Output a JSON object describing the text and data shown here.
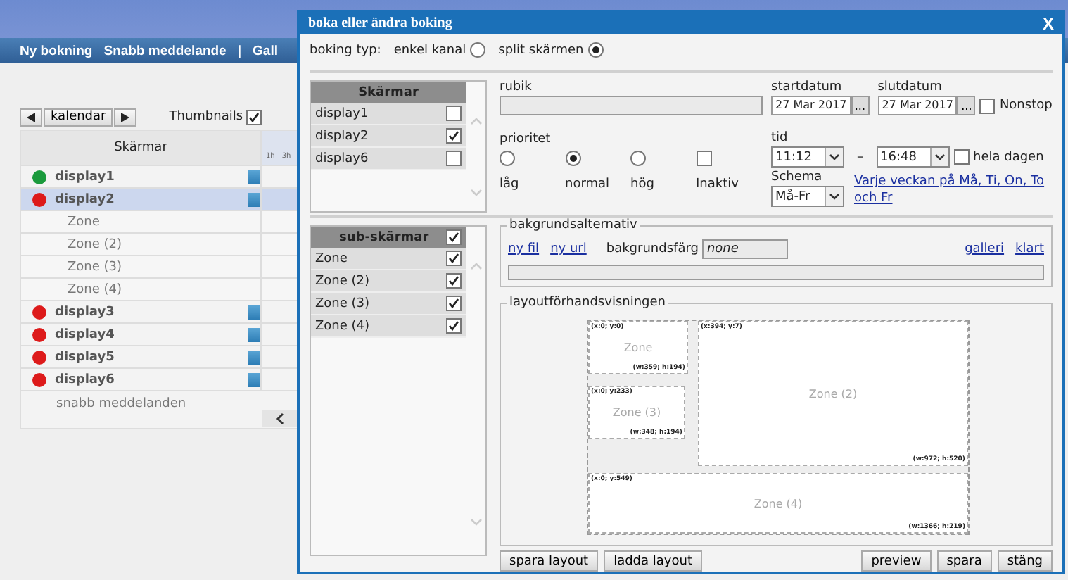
{
  "page": {
    "nav": [
      "Ny bokning",
      "Snabb meddelande",
      "|",
      "Gall"
    ],
    "calendar_button": "kalendar",
    "thumbnails": {
      "label": "Thumbnails",
      "checked": true
    },
    "column_header": "Skärmar",
    "timeline_ticks": [
      "1h",
      "3h"
    ],
    "displays": [
      {
        "name": "display1",
        "color": "#1a9a3c",
        "selected": false
      },
      {
        "name": "display2",
        "color": "#dd1a1a",
        "selected": true,
        "children": [
          {
            "name": "Zone"
          },
          {
            "name": "Zone (2)"
          },
          {
            "name": "Zone (3)"
          },
          {
            "name": "Zone (4)"
          }
        ]
      },
      {
        "name": "display3",
        "color": "#dd1a1a",
        "selected": false
      },
      {
        "name": "display4",
        "color": "#dd1a1a",
        "selected": false
      },
      {
        "name": "display5",
        "color": "#dd1a1a",
        "selected": false
      },
      {
        "name": "display6",
        "color": "#dd1a1a",
        "selected": false
      }
    ],
    "footer": "snabb meddelanden"
  },
  "dialog": {
    "title": "boka eller ändra boking",
    "close": "X",
    "booking_type": {
      "label": "boking typ:",
      "options": [
        {
          "label": "enkel kanal",
          "selected": false
        },
        {
          "label": "split skärmen",
          "selected": true
        }
      ]
    },
    "screens": {
      "header": "Skärmar",
      "items": [
        {
          "name": "display1",
          "checked": false
        },
        {
          "name": "display2",
          "checked": true
        },
        {
          "name": "display6",
          "checked": false
        }
      ]
    },
    "rubik": {
      "label": "rubik"
    },
    "startdatum": {
      "label": "startdatum",
      "value": "27 Mar 2017",
      "button": "..."
    },
    "slutdatum": {
      "label": "slutdatum",
      "value": "27 Mar 2017",
      "button": "..."
    },
    "nonstop": {
      "label": "Nonstop",
      "checked": false
    },
    "prioritet": {
      "label": "prioritet",
      "options": [
        {
          "kind": "radio",
          "label": "låg",
          "selected": false
        },
        {
          "kind": "radio",
          "label": "normal",
          "selected": true
        },
        {
          "kind": "radio",
          "label": "hög",
          "selected": false
        },
        {
          "kind": "checkbox",
          "label": "Inaktiv",
          "checked": false
        }
      ]
    },
    "tid": {
      "label": "tid",
      "from": "11:12",
      "separator": "–",
      "to": "16:48"
    },
    "hela_dagen": {
      "label": "hela dagen",
      "checked": false
    },
    "schema": {
      "label": "Schema",
      "value": "Må-Fr",
      "link": "Varje veckan på Må, Ti, On, To och Fr"
    },
    "sub_screens": {
      "header": "sub-skärmar",
      "checked": true,
      "items": [
        {
          "name": "Zone",
          "checked": true
        },
        {
          "name": "Zone (2)",
          "checked": true
        },
        {
          "name": "Zone (3)",
          "checked": true
        },
        {
          "name": "Zone (4)",
          "checked": true
        }
      ]
    },
    "background": {
      "legend": "bakgrundsalternativ",
      "links": [
        "ny fil",
        "ny url"
      ],
      "color_label": "bakgrundsfärg",
      "color_value": "none",
      "right_links": [
        "galleri",
        "klart"
      ]
    },
    "layout_preview": {
      "legend": "layoutförhandsvisningen",
      "zones": [
        {
          "name": "Zone",
          "position": "(x:0; y:0)",
          "size": "(w:359; h:194)"
        },
        {
          "name": "Zone (2)",
          "position": "(x:394; y:7)",
          "size": "(w:972; h:520)"
        },
        {
          "name": "Zone (3)",
          "position": "(x:0; y:233)",
          "size": "(w:348; h:194)"
        },
        {
          "name": "Zone (4)",
          "position": "(x:0; y:549)",
          "size": "(w:1366; h:219)"
        }
      ]
    },
    "left_buttons": [
      "spara layout",
      "ladda layout"
    ],
    "right_buttons": [
      "preview",
      "spara",
      "stäng"
    ]
  }
}
